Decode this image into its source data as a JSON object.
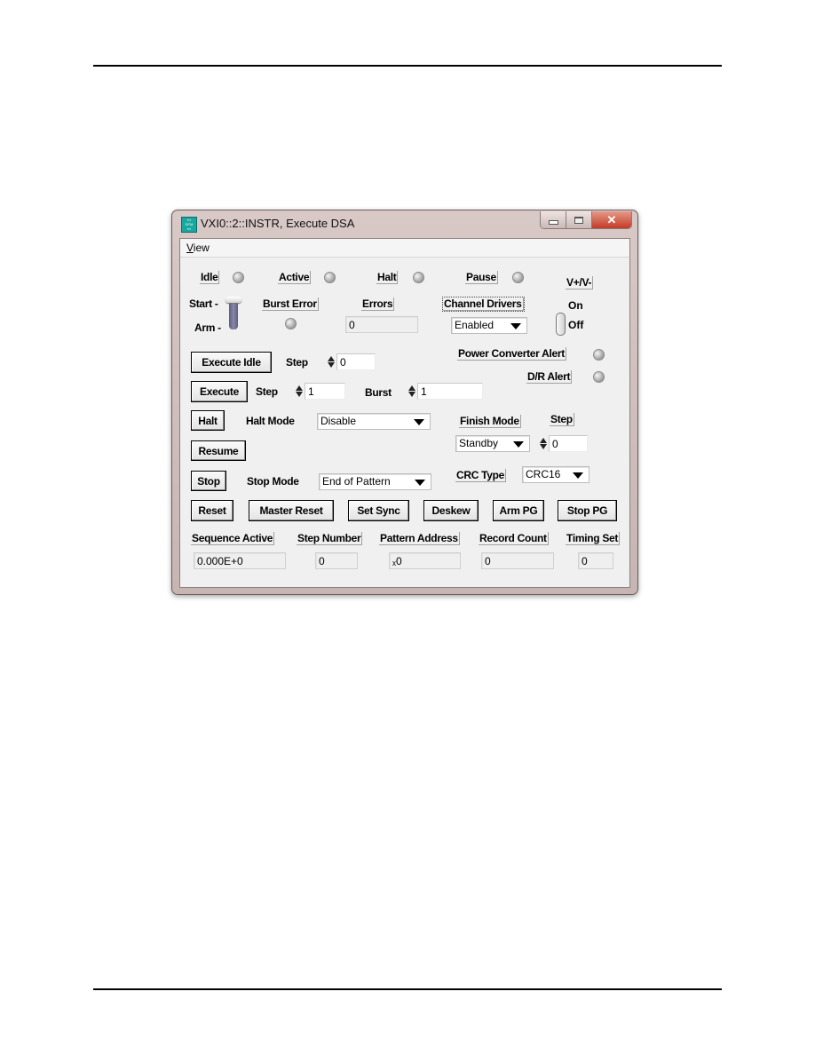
{
  "window": {
    "title": "VXI0::2::INSTR, Execute DSA",
    "icon": "app-icon",
    "caption_buttons": {
      "minimize": "minimize-icon",
      "maximize": "maximize-icon",
      "close": "✕"
    }
  },
  "menu": {
    "items": [
      {
        "label_prefix": "V",
        "label_rest": "iew"
      }
    ]
  },
  "status": {
    "idle": "Idle",
    "active": "Active",
    "halt": "Halt",
    "pause": "Pause",
    "vplus_vminus": "V+/V-"
  },
  "start_arm": {
    "start_label": "Start -",
    "arm_label": "Arm -",
    "position": "Start"
  },
  "burst_error": {
    "label": "Burst Error"
  },
  "errors": {
    "label": "Errors",
    "value": "0"
  },
  "channel_drivers": {
    "label": "Channel Drivers",
    "selected": "Enabled"
  },
  "power_switch": {
    "on_label": "On",
    "off_label": "Off",
    "state": "Off"
  },
  "execute_idle": {
    "button": "Execute Idle",
    "step_label": "Step",
    "step_value": "0"
  },
  "execute": {
    "button": "Execute",
    "step_label": "Step",
    "step_value": "1",
    "burst_label": "Burst",
    "burst_value": "1"
  },
  "alerts": {
    "power_converter": "Power Converter Alert",
    "dr": "D/R Alert"
  },
  "halt": {
    "button": "Halt",
    "mode_label": "Halt Mode",
    "mode_value": "Disable"
  },
  "resume": {
    "button": "Resume"
  },
  "stop": {
    "button": "Stop",
    "mode_label": "Stop Mode",
    "mode_value": "End of Pattern"
  },
  "finish": {
    "mode_label": "Finish Mode",
    "mode_value": "Standby",
    "step_label": "Step",
    "step_value": "0"
  },
  "crc": {
    "label": "CRC Type",
    "value": "CRC16"
  },
  "actions": [
    "Reset",
    "Master Reset",
    "Set Sync",
    "Deskew",
    "Arm PG",
    "Stop PG"
  ],
  "readouts": [
    {
      "label": "Sequence Active",
      "value": "0.000E+0"
    },
    {
      "label": "Step Number",
      "value": "0"
    },
    {
      "label": "Pattern Address",
      "value": "ₓ0"
    },
    {
      "label": "Record Count",
      "value": "0"
    },
    {
      "label": "Timing Set",
      "value": "0"
    }
  ]
}
